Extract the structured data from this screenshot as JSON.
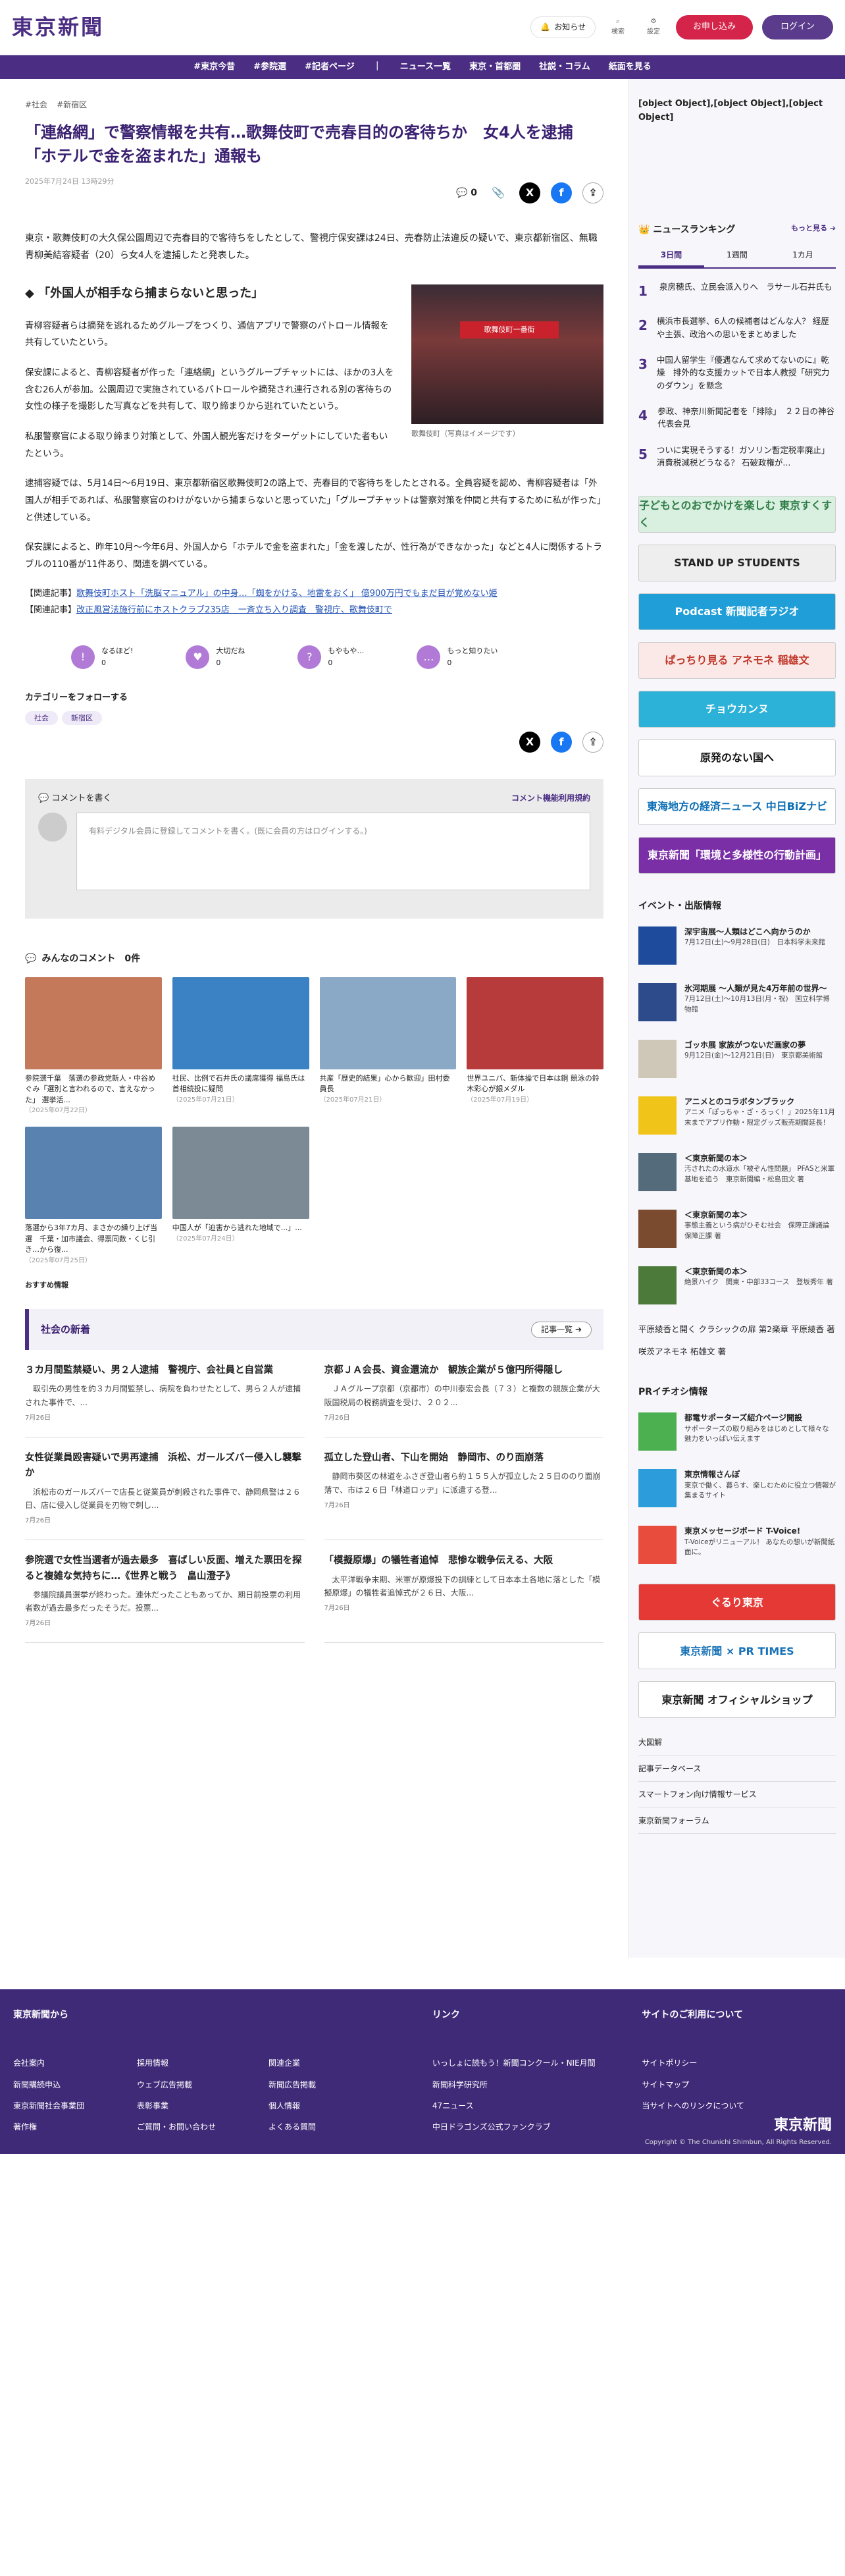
{
  "header": {
    "logo": "東京新聞",
    "notice": "お知らせ",
    "search": "検索",
    "settings": "設定",
    "signup": "お申し込み",
    "login": "ログイン"
  },
  "nav": [
    "#東京今昔",
    "#参院選",
    "#記者ページ",
    "ニュース一覧",
    "東京・首都圏",
    "社説・コラム",
    "紙面を見る"
  ],
  "article": {
    "tags": [
      "#社会",
      "#新宿区"
    ],
    "title": "「連絡網」で警察情報を共有…歌舞伎町で売春目的の客待ちか　女4人を逮捕　「ホテルで金を盗まれた」通報も",
    "date": "2025年7月24日 13時29分",
    "comments": "0",
    "lead": "東京・歌舞伎町の大久保公園周辺で売春目的で客待ちをしたとして、警視庁保安課は24日、売春防止法違反の疑いで、東京都新宿区、無職青柳美結容疑者（20）ら女4人を逮捕したと発表した。",
    "heading": "「外国人が相手なら捕まらないと思った」",
    "caption": "歌舞伎町（写真はイメージです）",
    "photo_sign": "歌舞伎町一番街",
    "paragraphs": [
      "青柳容疑者らは摘発を逃れるためグループをつくり、通信アプリで警察のパトロール情報を共有していたという。",
      "保安課によると、青柳容疑者が作った「連絡網」というグループチャットには、ほかの3人を含む26人が参加。公園周辺で実施されているパトロールや摘発され連行される別の客待ちの女性の様子を撮影した写真などを共有して、取り締まりから逃れていたという。",
      "私服警察官による取り締まり対策として、外国人観光客だけをターゲットにしていた者もいたという。",
      "逮捕容疑では、5月14日〜6月19日、東京都新宿区歌舞伎町2の路上で、売春目的で客待ちをしたとされる。全員容疑を認め、青柳容疑者は「外国人が相手であれば、私服警察官のわけがないから捕まらないと思っていた」「グループチャットは警察対策を仲間と共有するために私が作った」と供述している。",
      "保安課によると、昨年10月〜今年6月、外国人から「ホテルで金を盗まれた」「金を渡したが、性行為ができなかった」などと4人に関係するトラブルの110番が11件あり、関連を調べている。"
    ],
    "related": [
      {
        "label": "【関連記事】",
        "link": "歌舞伎町ホスト「洗脳マニュアル」の中身…「蜘をかける、地雷をおく」 億900万円でもまだ目が覚めない姫"
      },
      {
        "label": "【関連記事】",
        "link": "改正風営法施行前にホストクラブ235店　一斉立ち入り調査　警視庁、歌舞伎町で"
      }
    ]
  },
  "reactions": [
    {
      "icon": "!",
      "label": "なるほど!",
      "count": "0"
    },
    {
      "icon": "♥",
      "label": "大切だね",
      "count": "0"
    },
    {
      "icon": "?",
      "label": "もやもや…",
      "count": "0"
    },
    {
      "icon": "…",
      "label": "もっと知りたい",
      "count": "0"
    }
  ],
  "follow": {
    "title": "カテゴリーをフォローする",
    "chips": [
      "社会",
      "新宿区"
    ]
  },
  "comment": {
    "title": "コメントを書く",
    "rules": "コメント機能利用規約",
    "prompt": "有料デジタル会員に登録してコメントを書く。(既に会員の方はログインする。)"
  },
  "all_comments": "みんなのコメント　0件",
  "recommend": [
    {
      "cap": "参院選千葉　落選の参政党新人・中谷めぐみ「選別と言われるので、言えなかった」 選挙活...",
      "date": "（2025年07月22日）",
      "c": "#c47a5a"
    },
    {
      "cap": "社民、比例で石井氏の議席獲得 福島氏は首相続投に疑問",
      "date": "（2025年07月21日）",
      "c": "#3b82c4"
    },
    {
      "cap": "共産「歴史的結果」心から歓迎」田村委員長",
      "date": "（2025年07月21日）",
      "c": "#8aa9c6"
    },
    {
      "cap": "世界ユニバ、新体操で日本は銅 競泳の鈴木彩心が銀メダル",
      "date": "（2025年07月19日）",
      "c": "#b73b3b"
    },
    {
      "cap": "落選から3年7カ月、まさかの繰り上げ当選　千葉・加市議会、得票同数・くじ引き…から復...",
      "date": "（2025年07月25日）",
      "c": "#5a82b0"
    },
    {
      "cap": "中国人が「迫害から逃れた地域で...」...",
      "date": "（2025年07月24日）",
      "c": "#7b8a94"
    }
  ],
  "recommend_more": "おすすめ情報",
  "news": {
    "title": "社会の新着",
    "more": "記事一覧",
    "items": [
      {
        "t": "３カ月間監禁疑い、男２人逮捕　警視庁、会社員と自営業",
        "s": "　取引先の男性を約３カ月間監禁し、病院を負わせたとして、男ら２人が逮捕された事件で、...",
        "d": "7月26日"
      },
      {
        "t": "京都ＪＡ会長、資金還流か　観族企業が５億円所得隠し",
        "s": "　ＪＡグループ京都（京都市）の中川泰宏会長（７３）と複数の親族企業が大阪国税局の税務調査を受け、２０２...",
        "d": "7月26日"
      },
      {
        "t": "女性従業員殴害疑いで男再逮捕　浜松、ガールズバー侵入し襲撃か",
        "s": "　浜松市のガールズバーで店長と従業員が刺殺された事件で、静岡県警は２６日、店に侵入し従業員を刃物で刺し...",
        "d": "7月26日"
      },
      {
        "t": "孤立した登山者、下山を開始　静岡市、のり面崩落",
        "s": "　静岡市葵区の林道をふさぎ登山者ら約１５５人が孤立した２５日ののり面崩落で、市は２６日「林道ロッヂ」に派遣する登...",
        "d": "7月26日"
      },
      {
        "t": "参院選で女性当選者が過去最多　喜ばしい反面、増えた票田を探ると複雑な気持ちに…《世界と戦う　畠山澄子》",
        "s": "　参議院議員選挙が終わった。連休だったこともあってか、期日前投票の利用者数が過去最多だったそうだ。投票...",
        "d": "7月26日"
      },
      {
        "t": "「模擬原爆」の犠牲者追悼　悲惨な戦争伝える、大阪",
        "s": "　太平洋戦争末期、米軍が原爆投下の訓練として日本本土各地に落とした「模擬原爆」の犠牲者追悼式が２６日、大阪...",
        "d": "7月26日"
      }
    ]
  },
  "side": {
    "pr": [
      {
        "t": "都電サポーターズ紹介ページ開設",
        "d": "サポーターズの取り組みをはじめとして様々な魅力をいっぱい伝えます",
        "c": "#4caf50"
      },
      {
        "t": "東京情報さんぽ",
        "d": "東京で働く、暮らす、楽しむために役立つ情報が集まるサイト",
        "c": "#2d9cdb"
      },
      {
        "t": "東京メッセージボード T-Voice!",
        "d": "T-Voiceがリニューアル！ あなたの想いが新聞紙面に。",
        "c": "#e74c3c"
      }
    ],
    "ranking": "ニュースランキング",
    "more": "もっと見る",
    "tabs": [
      "3日間",
      "1週間",
      "1カ月"
    ],
    "ranks": [
      "泉房穂氏、立民会派入りへ　ラサール石井氏も",
      "横浜市長選挙、6人の候補者はどんな人？ 経歴や主張、政治への思いをまとめました",
      "中国人留学生『優遇なんて求めてないのに』乾燥　排外的な支援カットで日本人教授「研究力のダウン」を懸念",
      "参政、神奈川新聞記者を「排除」　２２日の神谷代表会見",
      "ついに実現そうする！ガソリン暫定税率廃止」消費税減税どうなる？ 石破政権が..."
    ],
    "banners": [
      {
        "t": "子どもとのおでかけを楽しむ 東京すくすく",
        "bg": "#d9efe0",
        "c": "#2f7d46"
      },
      {
        "t": "STAND UP STUDENTS",
        "bg": "#eeeeee",
        "c": "#222"
      },
      {
        "t": "Podcast 新聞記者ラジオ",
        "bg": "#1f9ed8",
        "c": "#fff"
      },
      {
        "t": "ぱっちり見る アネモネ 稲雄文",
        "bg": "#fbe9e8",
        "c": "#c0392b"
      },
      {
        "t": "チョウカンヌ",
        "bg": "#2cb1d8",
        "c": "#fff"
      },
      {
        "t": "原発のない国へ",
        "bg": "#fff",
        "c": "#111"
      },
      {
        "t": "東海地方の経済ニュース 中日BiZナビ",
        "bg": "#fff",
        "c": "#0a6db5"
      },
      {
        "t": "東京新聞「環境と多様性の行動計画」",
        "bg": "#7a2fa7",
        "c": "#fff"
      }
    ],
    "events_title": "イベント・出版情報",
    "events": [
      {
        "t": "深宇宙展〜人類はどこへ向かうのか",
        "d": "7月12日(土)〜9月28日(日)　日本科学未来館",
        "c": "#1e4b9c"
      },
      {
        "t": "氷河期展 〜人類が見た4万年前の世界〜",
        "d": "7月12日(土)〜10月13日(月・祝)　国立科学博物館",
        "c": "#2d4a8a"
      },
      {
        "t": "ゴッホ展 家族がつないだ画家の夢",
        "d": "9月12日(金)〜12月21日(日)　東京都美術館",
        "c": "#cfc7b8"
      },
      {
        "t": "アニメとのコラボタンブラック",
        "d": "アニメ「ぽっちゃ・ざ・ろっく！」2025年11月末までアプリ作動・限定グッズ販売期間延長！",
        "c": "#f0c419"
      },
      {
        "t": "＜東京新聞の本＞",
        "d": "汚されたの水道水「被ぞん性問題」 PFASと米軍基地を追う　東京新聞編・松島田文 著",
        "c": "#536b7a"
      },
      {
        "t": "＜東京新聞の本＞",
        "d": "事態主義という病がひそむ社会　保障正課議論　　保障正課 著",
        "c": "#7a4b2f"
      },
      {
        "t": "＜東京新聞の本＞",
        "d": "絶景ハイク　関東・中部33コース　登坂秀年 著",
        "c": "#4c7a3a"
      }
    ],
    "booklinks": [
      "平原綾香と開く クラシックの扉 第2楽章 平原綾香 著",
      "咲茨アネモネ 柘雄文 著"
    ],
    "pr_title": "PRイチオシ情報",
    "banners2": [
      {
        "t": "ぐるり東京",
        "bg": "#e53935",
        "c": "#fff"
      },
      {
        "t": "東京新聞 × PR TIMES",
        "bg": "#fff",
        "c": "#1a73b8"
      },
      {
        "t": "東京新聞 オフィシャルショップ",
        "bg": "#fff",
        "c": "#222"
      }
    ],
    "links": [
      "大図解",
      "記事データベース",
      "スマートフォン向け情報サービス",
      "東京新聞フォーラム"
    ]
  },
  "footer": {
    "c1": "東京新聞から",
    "c2": "リンク",
    "c3": "サイトのご利用について",
    "links1": [
      "会社案内",
      "新聞購読申込",
      "東京新聞社会事業団",
      "著作権"
    ],
    "links1b": [
      "採用情報",
      "ウェブ広告掲載",
      "表彰事業",
      "ご質問・お問い合わせ"
    ],
    "links1c": [
      "関連企業",
      "新聞広告掲載",
      "個人情報",
      "よくある質問"
    ],
    "links2": [
      "いっしょに読もう！新聞コンクール・NIE月間",
      "新聞科学研究所",
      "47ニュース",
      "中日ドラゴンズ公式ファンクラブ"
    ],
    "links3": [
      "サイトポリシー",
      "サイトマップ",
      "当サイトへのリンクについて"
    ],
    "logo": "東京新聞",
    "copy": "Copyright © The Chunichi Shimbun, All Rights Reserved."
  }
}
